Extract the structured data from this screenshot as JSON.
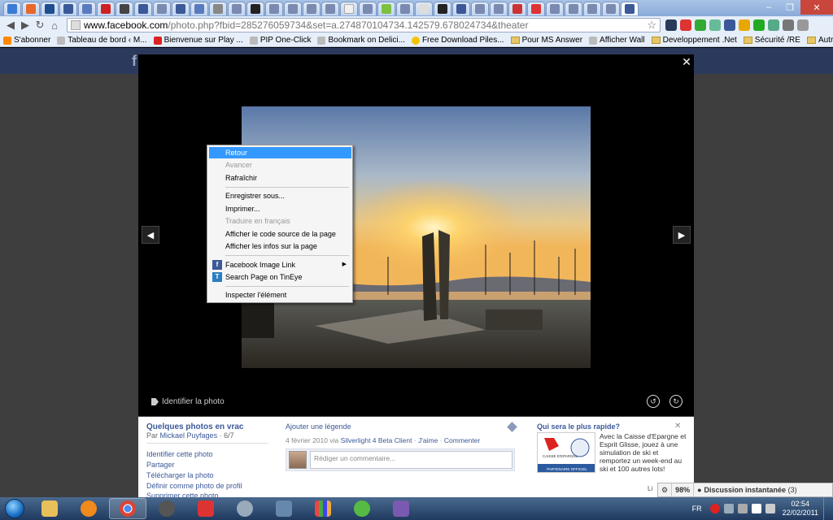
{
  "browser": {
    "url_host": "www.facebook.com",
    "url_rest": "/photo.php?fbid=285276059734&set=a.274870104734.142579.678024734&theater",
    "window_controls": [
      "–",
      "❐",
      "✕"
    ]
  },
  "bookmarks": [
    {
      "label": "S'abonner",
      "kind": "rss"
    },
    {
      "label": "Tableau de bord ‹ M...",
      "kind": "page"
    },
    {
      "label": "Bienvenue sur Play ...",
      "kind": "youtube"
    },
    {
      "label": "PIP One-Click",
      "kind": "page"
    },
    {
      "label": "Bookmark on Delici...",
      "kind": "page"
    },
    {
      "label": "Free Download Piles...",
      "kind": "page"
    },
    {
      "label": "Pour MS Answer",
      "kind": "folder"
    },
    {
      "label": "Afficher Wall",
      "kind": "page"
    },
    {
      "label": "Developpement .Net",
      "kind": "folder"
    },
    {
      "label": "Sécurité /RE",
      "kind": "folder"
    }
  ],
  "bookmarks_other": "Autres favoris",
  "facebook": {
    "logo": "f",
    "close": "✕",
    "prev": "◀",
    "next": "▶",
    "tag_photo": "Identifier la photo",
    "album_title": "Quelques photos en vrac",
    "album_by_prefix": "Par",
    "album_author": "Mickael Puyfages",
    "album_count": "· 6/7",
    "actions": [
      "Identifier cette photo",
      "Partager",
      "Télécharger la photo",
      "Définir comme photo de profil",
      "Supprimer cette photo"
    ],
    "add_caption": "Ajouter une légende",
    "meta_date": "4 février 2010 via",
    "meta_app": "Silverlight 4 Beta Client",
    "meta_like": "J'aime",
    "meta_comment": "Commenter",
    "comment_placeholder": "Rédiger un commentaire...",
    "ad_title": "Qui sera le plus rapide?",
    "ad_close": "✕",
    "ad_text": "Avec la Caisse d'Epargne et Esprit Glisse, jouez à une simulation de ski et remportez un week-end au ski et 100 autres lots!",
    "ad_img_label": "PARTENAIRE OFFICIEL",
    "ad_brand": "CAISSE D'EPARGNE",
    "partial_link": "Li"
  },
  "chat": {
    "percent": "98%",
    "label": "Discussion instantanée",
    "count": "(3)"
  },
  "context_menu": [
    {
      "label": "Retour",
      "state": "highlight"
    },
    {
      "label": "Avancer",
      "state": "disabled"
    },
    {
      "label": "Rafraîchir",
      "state": "normal"
    },
    {
      "sep": true
    },
    {
      "label": "Enregistrer sous...",
      "state": "normal"
    },
    {
      "label": "Imprimer...",
      "state": "normal"
    },
    {
      "label": "Traduire en français",
      "state": "disabled"
    },
    {
      "label": "Afficher le code source de la page",
      "state": "normal"
    },
    {
      "label": "Afficher les infos sur la page",
      "state": "normal"
    },
    {
      "sep": true
    },
    {
      "label": "Facebook Image Link",
      "state": "normal",
      "icon": "f",
      "icon_color": "#3b5998",
      "submenu": true
    },
    {
      "label": "Search Page on TinEye",
      "state": "normal",
      "icon": "T",
      "icon_color": "#2a7fc2"
    },
    {
      "sep": true
    },
    {
      "label": "Inspecter l'élément",
      "state": "normal"
    }
  ],
  "taskbar": {
    "lang": "FR",
    "time": "02:54",
    "date": "22/02/2011"
  },
  "colors": {
    "fb_blue": "#3b5998",
    "menu_highlight": "#3399ff"
  }
}
